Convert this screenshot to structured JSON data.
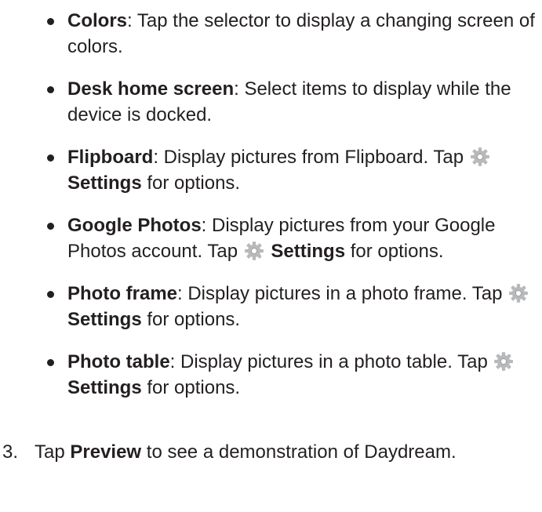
{
  "bullets": [
    {
      "term": "Colors",
      "text": ": Tap the selector to display a changing screen of colors."
    },
    {
      "term": "Desk home screen",
      "text": ": Select items to display while the device is docked."
    },
    {
      "term": "Flipboard",
      "text": ": Display pictures from Flipboard. Tap",
      "settings_label": "Settings",
      "after": " for options."
    },
    {
      "term": "Google Photos",
      "text": ": Display pictures from your Google Photos account. Tap",
      "settings_label": "Settings",
      "after": " for options."
    },
    {
      "term": "Photo frame",
      "text": ": Display pictures in a photo frame. Tap",
      "settings_label": "Settings",
      "after": " for options."
    },
    {
      "term": "Photo table",
      "text": ": Display pictures in a photo table. Tap",
      "settings_label": "Settings",
      "after": " for options."
    }
  ],
  "step": {
    "number": "3.",
    "before": "Tap ",
    "term": "Preview",
    "after": " to see a demonstration of Daydream."
  },
  "icons": {
    "settings": "gear-icon",
    "gear_color_light": "#b8b9bb",
    "gear_color_dark": "#8a8b8d"
  }
}
